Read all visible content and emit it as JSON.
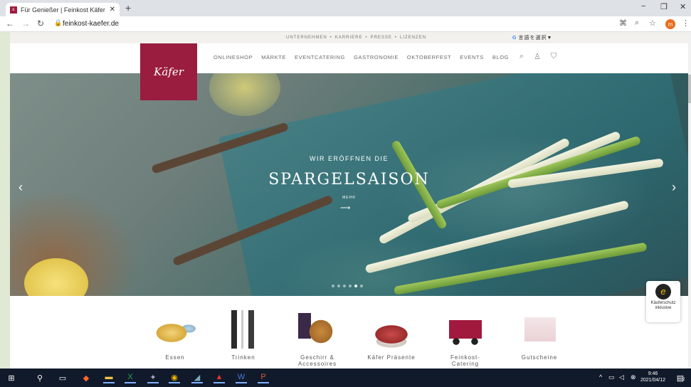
{
  "browser": {
    "tab_title": "Für Genießer | Feinkost Käfer Onl",
    "tab_close": "✕",
    "new_tab": "+",
    "url": "feinkost-kaefer.de",
    "win_min": "−",
    "win_max": "❐",
    "win_close": "✕",
    "profile_initial": "m"
  },
  "page": {
    "top_links": [
      "UNTERNEHMEN",
      "•",
      "KARRIERE",
      "•",
      "PRESSE",
      "•",
      "LIZENZEN"
    ],
    "translate_label": "言語を選択▼",
    "logo_text": "Käfer",
    "nav": [
      "ONLINESHOP",
      "MÄRKTE",
      "EVENTCATERING",
      "GASTRONOMIE",
      "OKTOBERFEST",
      "EVENTS",
      "BLOG"
    ],
    "hero": {
      "subtitle": "WIR ERÖFFNEN DIE",
      "title": "SPARGELSAISON",
      "more": "MEHR",
      "slides": 6,
      "active_slide": 5
    },
    "categories": [
      "Essen",
      "Trinken",
      "Geschirr & Accessoires",
      "Käfer Präsente",
      "Feinkost-Catering",
      "Gutscheine"
    ],
    "trust": {
      "line1": "Käuferschutz",
      "line2": "inklusive"
    }
  },
  "taskbar": {
    "time": "9:46",
    "date": "2021/04/12",
    "notifications": "2"
  },
  "colors": {
    "brand": "#9a1c3e",
    "taskbar": "#111a2a"
  }
}
